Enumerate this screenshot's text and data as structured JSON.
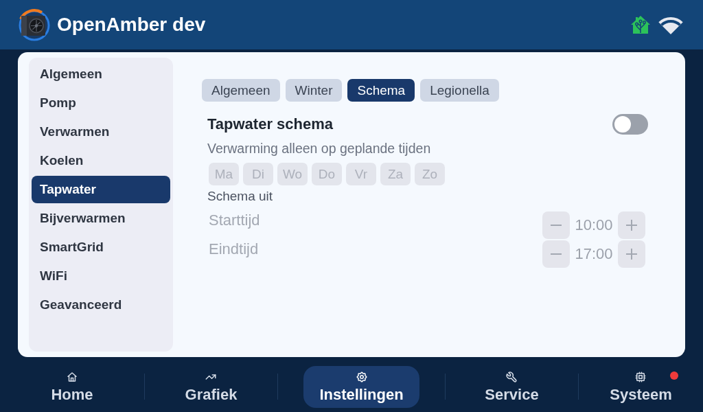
{
  "header": {
    "title": "OpenAmber dev"
  },
  "sidebar": {
    "items": [
      {
        "label": "Algemeen",
        "selected": false
      },
      {
        "label": "Pomp",
        "selected": false
      },
      {
        "label": "Verwarmen",
        "selected": false
      },
      {
        "label": "Koelen",
        "selected": false
      },
      {
        "label": "Tapwater",
        "selected": true
      },
      {
        "label": "Bijverwarmen",
        "selected": false
      },
      {
        "label": "SmartGrid",
        "selected": false
      },
      {
        "label": "WiFi",
        "selected": false
      },
      {
        "label": "Geavanceerd",
        "selected": false
      }
    ]
  },
  "tabs": [
    {
      "label": "Algemeen",
      "selected": false
    },
    {
      "label": "Winter",
      "selected": false
    },
    {
      "label": "Schema",
      "selected": true
    },
    {
      "label": "Legionella",
      "selected": false
    }
  ],
  "schedule": {
    "title": "Tapwater schema",
    "on": false,
    "description": "Verwarming alleen op geplande tijden",
    "days": [
      {
        "label": "Ma",
        "selected": false,
        "disabled": true
      },
      {
        "label": "Di",
        "selected": false,
        "disabled": true
      },
      {
        "label": "Wo",
        "selected": false,
        "disabled": true
      },
      {
        "label": "Do",
        "selected": false,
        "disabled": true
      },
      {
        "label": "Vr",
        "selected": false,
        "disabled": true
      },
      {
        "label": "Za",
        "selected": false,
        "disabled": true
      },
      {
        "label": "Zo",
        "selected": false,
        "disabled": true
      }
    ],
    "status": "Schema uit",
    "times": [
      {
        "label": "Starttijd",
        "value": "10:00",
        "disabled": true
      },
      {
        "label": "Eindtijd",
        "value": "17:00",
        "disabled": true
      }
    ]
  },
  "nav": [
    {
      "label": "Home",
      "kind": "home",
      "selected": false,
      "alert": false
    },
    {
      "label": "Grafiek",
      "kind": "chart",
      "selected": false,
      "alert": false
    },
    {
      "label": "Instellingen",
      "kind": "settings",
      "selected": true,
      "alert": false
    },
    {
      "label": "Service",
      "kind": "wrench",
      "selected": false,
      "alert": false
    },
    {
      "label": "Systeem",
      "kind": "chip",
      "selected": false,
      "alert": true
    }
  ]
}
